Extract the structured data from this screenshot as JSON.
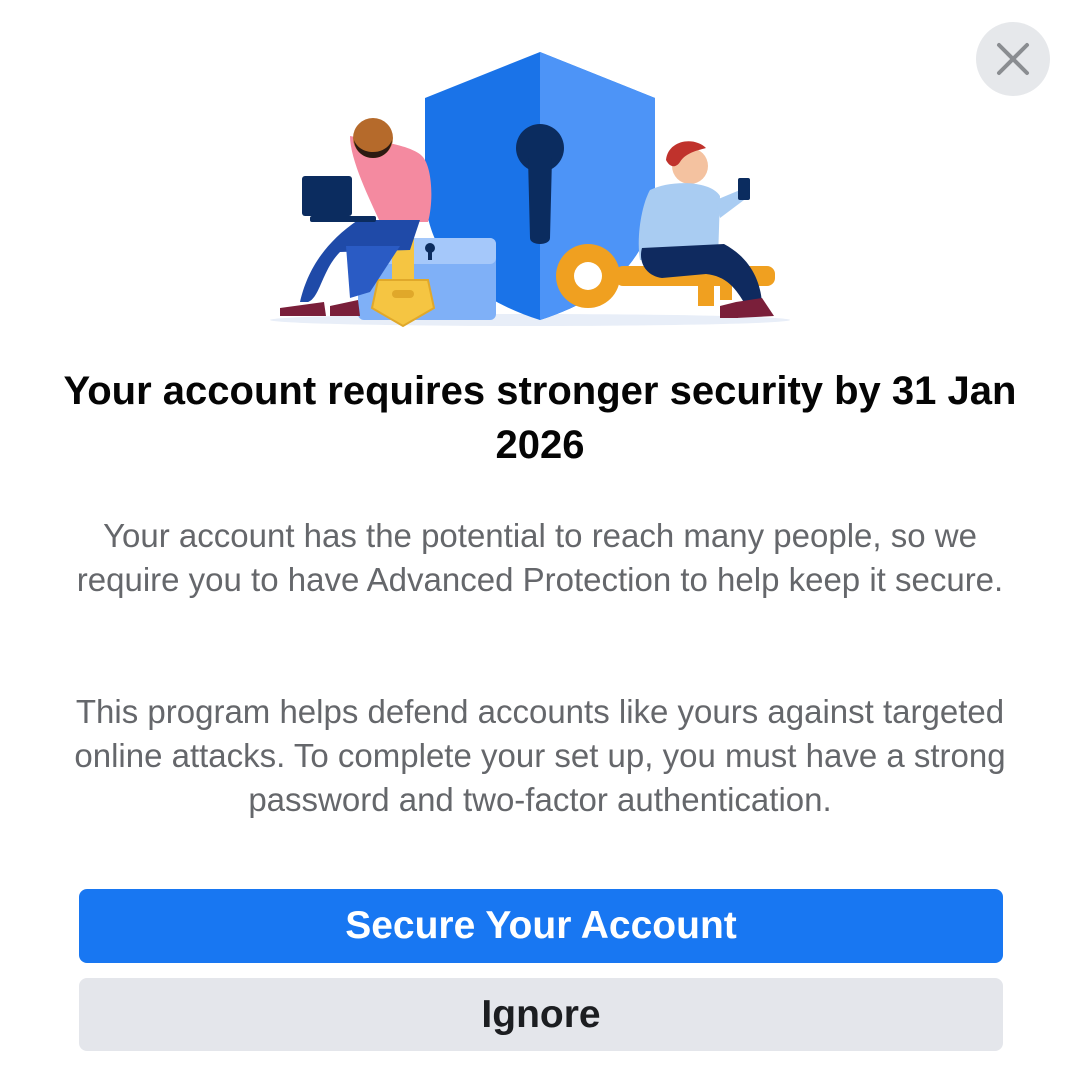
{
  "dialog": {
    "close_icon": "close-icon",
    "illustration": "security-shield-keys-illustration",
    "title": "Your account requires stronger security by 31 Jan 2026",
    "paragraph_1": "Your account has the potential to reach many people, so we require you to have Advanced Protection to help keep it secure.",
    "paragraph_2": "This program helps defend accounts like yours against targeted online attacks. To complete your set up, you must have a strong password and two-factor authentication.",
    "primary_button_label": "Secure Your Account",
    "secondary_button_label": "Ignore"
  },
  "colors": {
    "accent": "#1877f2",
    "secondary_button_bg": "#e4e6eb",
    "close_button_bg": "#e6e8eb",
    "title_text": "#050505",
    "body_text": "#65676b"
  }
}
